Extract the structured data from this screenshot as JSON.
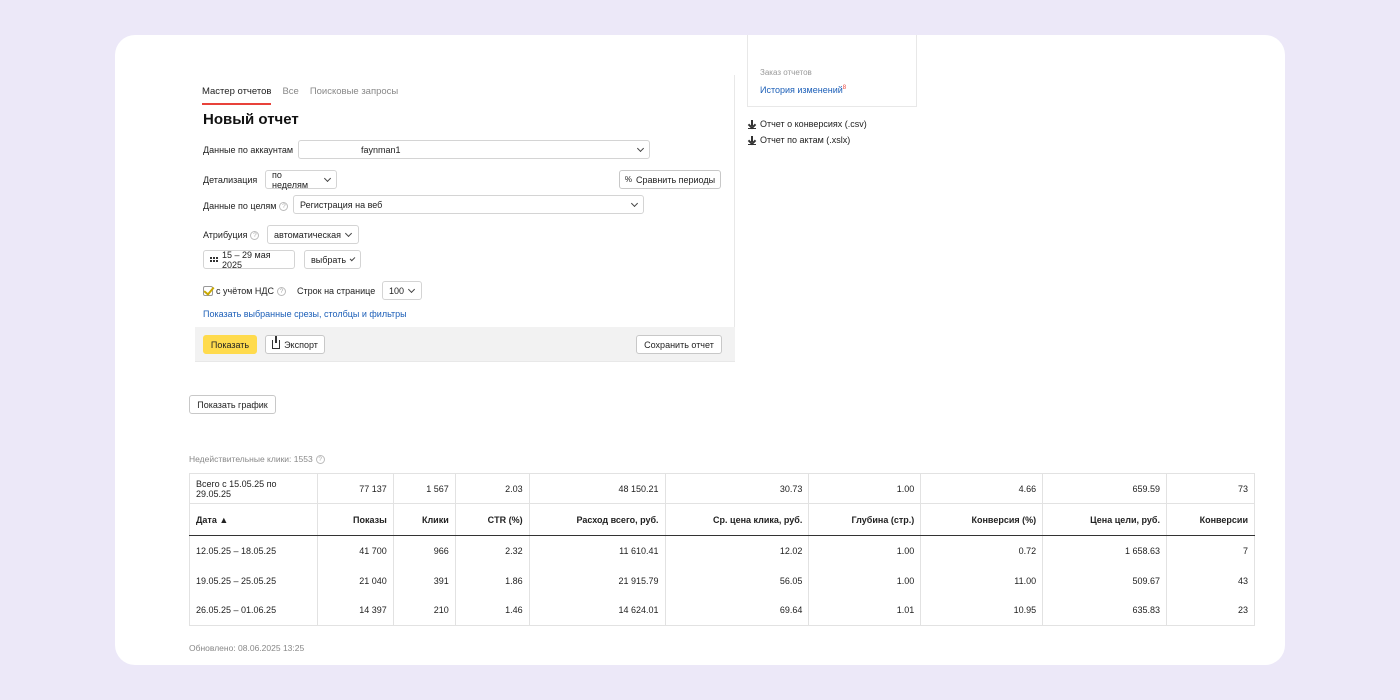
{
  "tabs": [
    {
      "label": "Мастер отчетов",
      "active": true
    },
    {
      "label": "Все",
      "active": false
    },
    {
      "label": "Поисковые запросы",
      "active": false
    }
  ],
  "page_title": "Новый отчет",
  "form": {
    "accounts_label": "Данные по аккаунтам",
    "accounts_value": "faynman1",
    "detail_label": "Детализация",
    "detail_value": "по неделям",
    "compare_label": "Сравнить периоды",
    "goals_label": "Данные по целям",
    "goals_value": "Регистрация на веб",
    "attribution_label": "Атрибуция",
    "attribution_value": "автоматическая",
    "date_range": "15 – 29 мая 2025",
    "date_choose": "выбрать",
    "vat_label": "с учётом НДС",
    "rows_label": "Строк на странице",
    "rows_value": "100",
    "show_selected_link": "Показать выбранные срезы, столбцы и фильтры"
  },
  "actions": {
    "show": "Показать",
    "export": "Экспорт",
    "save": "Сохранить отчет"
  },
  "side": {
    "partial_top": "Заказ отчетов",
    "history": "История изменений",
    "history_badge": "8",
    "conv_report": "Отчет о конверсиях (.csv)",
    "acts_report": "Отчет по актам (.xslx)"
  },
  "show_chart": "Показать график",
  "invalid_clicks": "Недействительные клики: 1553",
  "table": {
    "total": {
      "label": "Всего с 15.05.25 по 29.05.25",
      "values": [
        "77 137",
        "1 567",
        "2.03",
        "48 150.21",
        "30.73",
        "1.00",
        "4.66",
        "659.59",
        "73"
      ]
    },
    "headers": [
      "Дата ▲",
      "Показы",
      "Клики",
      "CTR (%)",
      "Расход всего, руб.",
      "Ср. цена клика, руб.",
      "Глубина (стр.)",
      "Конверсия (%)",
      "Цена цели, руб.",
      "Конверсии"
    ],
    "rows": [
      [
        "12.05.25 – 18.05.25",
        "41 700",
        "966",
        "2.32",
        "11 610.41",
        "12.02",
        "1.00",
        "0.72",
        "1 658.63",
        "7"
      ],
      [
        "19.05.25 – 25.05.25",
        "21 040",
        "391",
        "1.86",
        "21 915.79",
        "56.05",
        "1.00",
        "11.00",
        "509.67",
        "43"
      ],
      [
        "26.05.25 – 01.06.25",
        "14 397",
        "210",
        "1.46",
        "14 624.01",
        "69.64",
        "1.01",
        "10.95",
        "635.83",
        "23"
      ]
    ]
  },
  "updated": "Обновлено: 08.06.2025 13:25",
  "colors": {
    "accent": "#ffdb4d",
    "tab_active": "#e8423a",
    "link": "#1c5fb8",
    "background": "#ece8f8"
  }
}
